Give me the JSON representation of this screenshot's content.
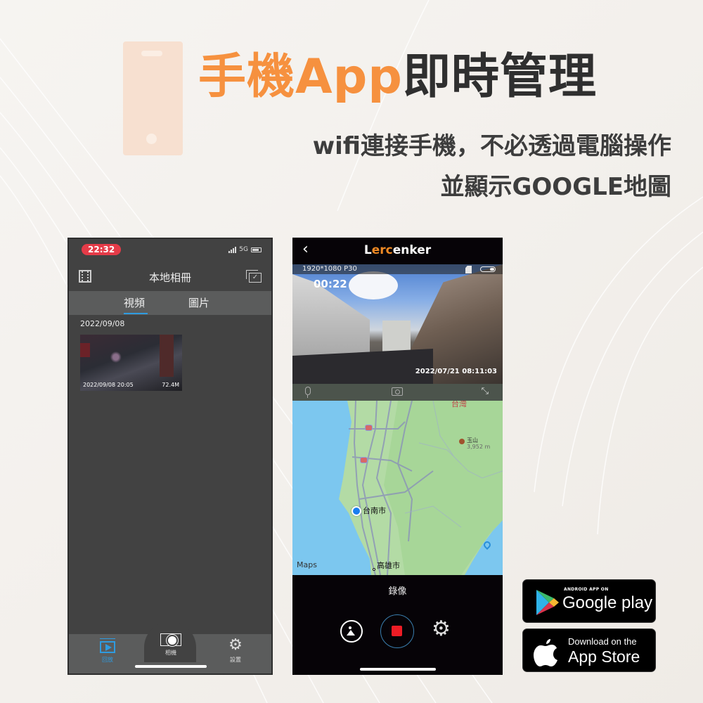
{
  "header": {
    "title_orange": "手機App",
    "title_dark": "即時管理",
    "subtitle_line1": "wifi連接手機，不必透過電腦操作",
    "subtitle_line2": "並顯示GOOGLE地圖",
    "accent_color": "#f6913f",
    "decor_icon": "smartphone-icon"
  },
  "left_phone": {
    "status": {
      "time": "22:32",
      "network": "5G"
    },
    "header": {
      "title": "本地相冊",
      "left_icon": "film-icon",
      "right_icon": "select-icon"
    },
    "tabs": [
      {
        "label": "視頻",
        "active": true
      },
      {
        "label": "圖片",
        "active": false
      }
    ],
    "groups": [
      {
        "date": "2022/09/08",
        "items": [
          {
            "timestamp": "2022/09/08  20:05",
            "size": "72.4M"
          }
        ]
      }
    ],
    "bottom_nav": [
      {
        "label": "回放",
        "icon": "playback-icon",
        "active": true
      },
      {
        "label": "相機",
        "icon": "camera-icon",
        "active": false
      },
      {
        "label": "設置",
        "icon": "gear-icon",
        "active": false
      }
    ],
    "active_color": "#2e9be0"
  },
  "right_phone": {
    "brand": {
      "prefix": "L",
      "highlight": "erc",
      "suffix": "enker"
    },
    "video": {
      "resolution": "1920*1080 P30",
      "timer": "00:22",
      "timestamp": "2022/07/21  08:11:03"
    },
    "map": {
      "labels": {
        "taiwan": "台灣",
        "yushan": "玉山",
        "yushan_elev": "3,952 m",
        "tainan": "台南市",
        "kaohsiung": "高雄市",
        "maps_logo": "Maps"
      }
    },
    "controls": {
      "mode_label": "錄像",
      "record_color": "#ee1c25"
    }
  },
  "stores": {
    "google_play": {
      "small": "ANDROID APP ON",
      "big_a": "Google",
      "big_b": " play"
    },
    "app_store": {
      "small": "Download on the",
      "big": "App Store"
    }
  }
}
